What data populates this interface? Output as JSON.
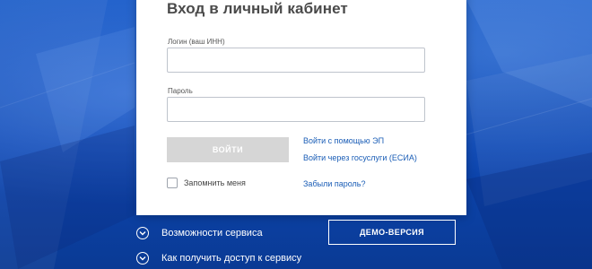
{
  "login_card": {
    "title": "Вход в личный кабинет",
    "login_label": "Логин (ваш ИНН)",
    "login_value": "",
    "password_label": "Пароль",
    "password_value": "",
    "login_button": "ВОЙТИ",
    "ep_link": "Войти с помощью ЭП",
    "esia_link": "Войти через госуслуги (ЕСИА)",
    "remember_label": "Запомнить меня",
    "remember_checked": false,
    "forgot_link": "Забыли пароль?"
  },
  "footer": {
    "features_label": "Возможности сервиса",
    "access_label": "Как получить доступ к сервису",
    "demo_button": "ДЕМО-ВЕРСИЯ",
    "features_icon": "chevron-down-circle-icon",
    "access_icon": "chevron-down-circle-icon"
  },
  "colors": {
    "background": "#0d47b3",
    "link": "#1a5db6",
    "disabled_button": "#d6d6d6"
  }
}
